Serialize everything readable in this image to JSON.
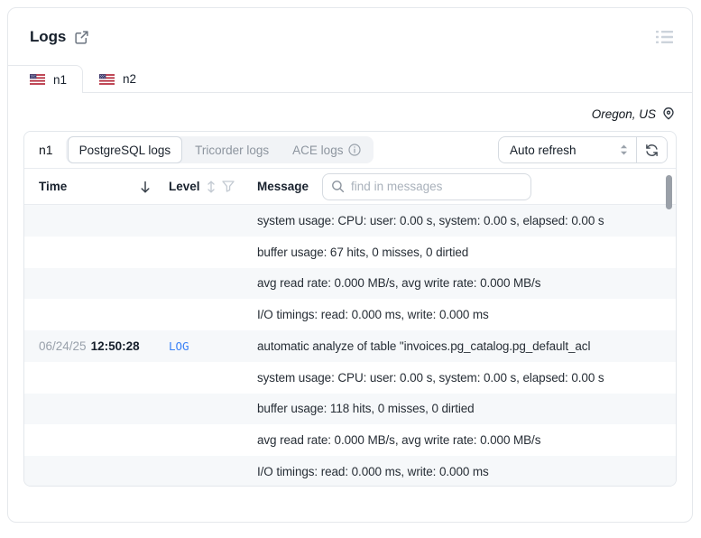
{
  "header": {
    "title": "Logs"
  },
  "tabs": [
    {
      "label": "n1",
      "active": true
    },
    {
      "label": "n2",
      "active": false
    }
  ],
  "region": {
    "label": "Oregon, US"
  },
  "toolbar": {
    "node_label": "n1",
    "sources": [
      {
        "label": "PostgreSQL logs",
        "active": true
      },
      {
        "label": "Tricorder logs",
        "active": false
      },
      {
        "label": "ACE logs",
        "active": false,
        "has_info": true
      }
    ],
    "auto_refresh_label": "Auto refresh"
  },
  "table": {
    "headers": {
      "time": "Time",
      "level": "Level",
      "message": "Message"
    },
    "search": {
      "placeholder": "find in messages"
    },
    "rows": [
      {
        "date": "",
        "time": "",
        "level": "",
        "message": "system usage: CPU: user: 0.00 s, system: 0.00 s, elapsed: 0.00 s"
      },
      {
        "date": "",
        "time": "",
        "level": "",
        "message": "buffer usage: 67 hits, 0 misses, 0 dirtied"
      },
      {
        "date": "",
        "time": "",
        "level": "",
        "message": "avg read rate: 0.000 MB/s, avg write rate: 0.000 MB/s"
      },
      {
        "date": "",
        "time": "",
        "level": "",
        "message": "I/O timings: read: 0.000 ms, write: 0.000 ms"
      },
      {
        "date": "06/24/25",
        "time": "12:50:28",
        "level": "LOG",
        "message": "automatic analyze of table \"invoices.pg_catalog.pg_default_acl"
      },
      {
        "date": "",
        "time": "",
        "level": "",
        "message": "system usage: CPU: user: 0.00 s, system: 0.00 s, elapsed: 0.00 s"
      },
      {
        "date": "",
        "time": "",
        "level": "",
        "message": "buffer usage: 118 hits, 0 misses, 0 dirtied"
      },
      {
        "date": "",
        "time": "",
        "level": "",
        "message": "avg read rate: 0.000 MB/s, avg write rate: 0.000 MB/s"
      },
      {
        "date": "",
        "time": "",
        "level": "",
        "message": "I/O timings: read: 0.000 ms, write: 0.000 ms"
      }
    ]
  },
  "colors": {
    "accent_blue": "#3b82f6",
    "card_border": "#e5e8ec",
    "row_alt_bg": "#f6f8fa",
    "muted_text": "#8d959f"
  }
}
